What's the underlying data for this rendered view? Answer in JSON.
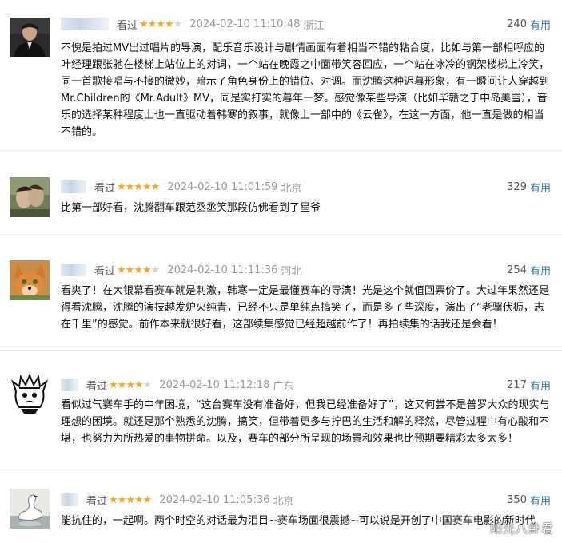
{
  "comments": [
    {
      "username": "用户",
      "status": "看过",
      "rating": 4,
      "star_filled": "★★★★",
      "star_empty": "★",
      "time": "2024-02-10 11:10:48",
      "location": "浙江",
      "votes": "240",
      "vote_label": "有用",
      "content": "不愧是拍过MV出过唱片的导演，配乐音乐设计与剧情画面有着相当不错的粘合度，比如与第一部相呼应的叶经理跟张驰在楼梯上站位上的对词，一个站在晚霞之中面带笑容回应，一个站在冰冷的钢架楼梯上冷笑，同一首歌接唱与不接的微妙，暗示了角色身份上的错位、对调。而沈腾这种迟暮形象，有一瞬间让人穿越到Mr.Children的《Mr.Adult》MV，同是实打实的暮年一梦。感觉像某些导演（比如毕赣之于中岛美雪），音乐的选择某种程度上也一直驱动着韩寒的叙事，就像上一部中的《云雀》，在这一方面，他一直是做的相当不错的。"
    },
    {
      "username": "用户",
      "status": "看过",
      "rating": 5,
      "star_filled": "★★★★★",
      "star_empty": "",
      "time": "2024-02-10 11:01:59",
      "location": "北京",
      "votes": "329",
      "vote_label": "有用",
      "content": "比第一部好看，沈腾翻车跟范丞丞笑那段仿佛看到了星爷"
    },
    {
      "username": "用户",
      "status": "看过",
      "rating": 4,
      "star_filled": "★★★★",
      "star_empty": "★",
      "time": "2024-02-10 11:11:36",
      "location": "河北",
      "votes": "254",
      "vote_label": "有用",
      "content": "看爽了！在大银幕看赛车就是刺激，韩寒一定是最懂赛车的导演！光是这个就值回票价了。大过年果然还是得看沈腾，沈腾的演技越发炉火纯青，已经不只是单纯点搞笑了，而是多了些深度，演出了“老骥伏枥，志在千里”的感觉。前作本来就很好看，这部续集感觉已经超越前作了！再拍续集的话我还是会看！"
    },
    {
      "username": "用户",
      "status": "看过",
      "rating": 4,
      "star_filled": "★★★★",
      "star_empty": "★",
      "time": "2024-02-10 11:12:18",
      "location": "广东",
      "votes": "217",
      "vote_label": "有用",
      "content": "看似过气赛车手的中年困境，“这台赛车没有准备好，但我已经准备好了”，这又何尝不是普罗大众的现实与理想的困境。就还是那个熟悉的沈腾，搞笑，但带着更多与拧巴的生活和解的释然，尽管过程中有心酸和不堪，也努力为所热爱的事物拼命。以及，赛车的部分所呈现的场景和效果也比预期要精彩太多太多！"
    },
    {
      "username": "用户",
      "status": "看过",
      "rating": 5,
      "star_filled": "★★★★★",
      "star_empty": "",
      "time": "2024-02-10 11:05:36",
      "location": "北京",
      "votes": "350",
      "vote_label": "有用",
      "content": "能抗住的，一起啊。两个时空的对话最为泪目~赛车场面很震撼~可以说是开创了中国赛车电影的新时代"
    }
  ],
  "watermark": "阳光八卦君"
}
